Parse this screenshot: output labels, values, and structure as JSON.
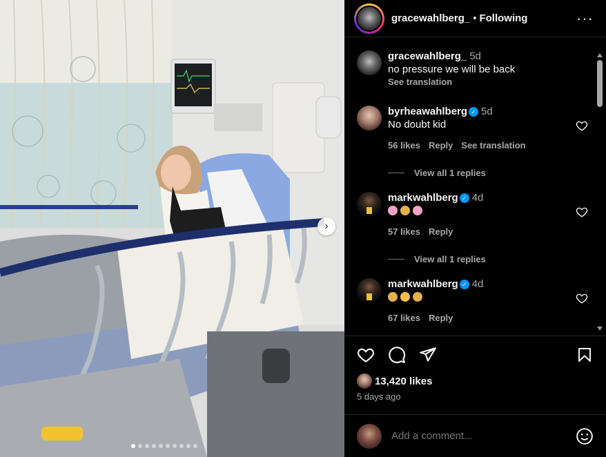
{
  "post": {
    "username": "gracewahlberg_",
    "separator": "•",
    "following_label": "Following",
    "more_label": "···",
    "next_label": "›",
    "carousel": {
      "count": 10,
      "current": 0
    }
  },
  "comments": [
    {
      "username": "gracewahlberg_",
      "verified": false,
      "time": "5d",
      "text": "no pressure we will be back",
      "see_translation": "See translation",
      "likes": "",
      "reply": "",
      "avatar": "grace"
    },
    {
      "username": "byrheawahlberg",
      "verified": true,
      "time": "5d",
      "text": "No doubt kid",
      "likes": "56 likes",
      "reply": "Reply",
      "see_translation": "See translation",
      "view_replies": "View all 1 replies",
      "avatar": "rhea"
    },
    {
      "username": "markwahlberg",
      "verified": true,
      "time": "4d",
      "emojis": [
        "pink-heart",
        "praying-hands",
        "pink-heart"
      ],
      "likes": "57 likes",
      "reply": "Reply",
      "view_replies": "View all 1 replies",
      "avatar": "mark"
    },
    {
      "username": "markwahlberg",
      "verified": true,
      "time": "4d",
      "emojis": [
        "praying-hands",
        "flushed-face",
        "praying-hands"
      ],
      "likes": "67 likes",
      "reply": "Reply",
      "avatar": "mark"
    }
  ],
  "actions": {
    "icons": [
      "heart-icon",
      "comment-icon",
      "share-icon",
      "bookmark-icon"
    ],
    "likes_count": "13,420 likes",
    "time_ago": "5 days ago"
  },
  "add_comment": {
    "placeholder": "Add a comment..."
  },
  "colors": {
    "verified": "#0095f6",
    "text_secondary": "#a8a8a8",
    "divider": "#262626",
    "background": "#000000"
  }
}
